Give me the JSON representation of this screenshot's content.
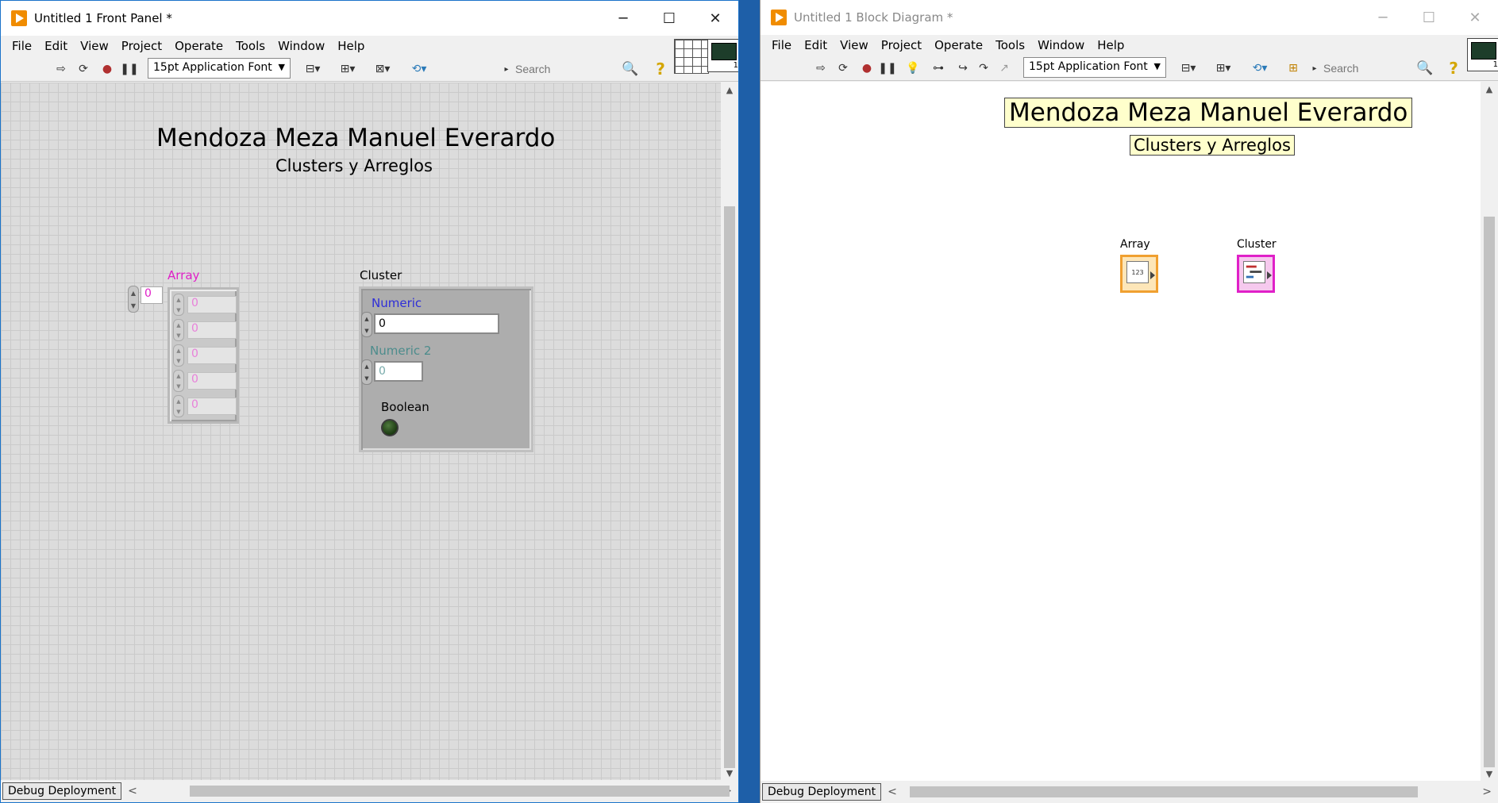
{
  "front_panel": {
    "title": "Untitled 1 Front Panel *",
    "controls": {
      "minimize": "─",
      "maximize": "☐",
      "close": "✕"
    },
    "menu": [
      "File",
      "Edit",
      "View",
      "Project",
      "Operate",
      "Tools",
      "Window",
      "Help"
    ],
    "toolbar": {
      "font": "15pt Application Font",
      "search_placeholder": "Search"
    },
    "connector_icon_number": "1",
    "canvas": {
      "title": "Mendoza Meza Manuel Everardo",
      "subtitle": "Clusters y Arreglos",
      "array": {
        "label": "Array",
        "index": "0",
        "elements": [
          "0",
          "0",
          "0",
          "0",
          "0"
        ]
      },
      "cluster": {
        "label": "Cluster",
        "numeric_label": "Numeric",
        "numeric_value": "0",
        "numeric2_label": "Numeric 2",
        "numeric2_value": "0",
        "boolean_label": "Boolean"
      }
    },
    "status": {
      "target": "Debug Deployment"
    }
  },
  "block_diagram": {
    "title": "Untitled 1 Block Diagram *",
    "controls": {
      "minimize": "─",
      "maximize": "☐",
      "close": "✕"
    },
    "menu": [
      "File",
      "Edit",
      "View",
      "Project",
      "Operate",
      "Tools",
      "Window",
      "Help"
    ],
    "toolbar": {
      "font": "15pt Application Font",
      "search_placeholder": "Search"
    },
    "connector_icon_number": "1",
    "canvas": {
      "title": "Mendoza Meza Manuel Everardo",
      "subtitle": "Clusters y Arreglos",
      "array_terminal_label": "Array",
      "array_terminal_text": "123",
      "cluster_terminal_label": "Cluster"
    },
    "status": {
      "target": "Debug Deployment"
    }
  },
  "colors": {
    "array_label": "#e020c8",
    "numeric_label": "#2f2fd8",
    "numeric2_label": "#4c8c8c",
    "desktop": "#1e5fa8",
    "free_label_bg": "#ffffcc"
  }
}
